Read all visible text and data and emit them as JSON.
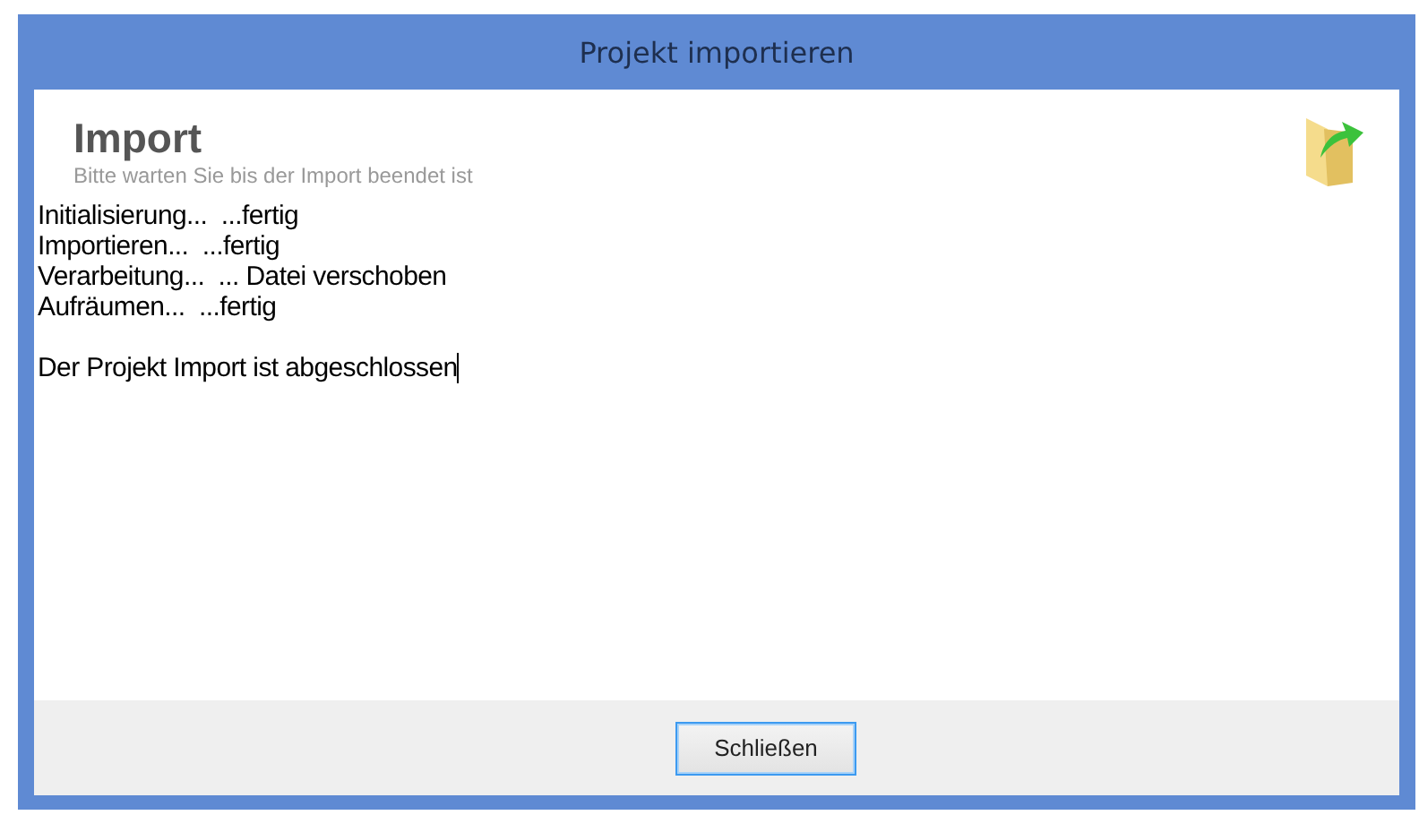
{
  "window": {
    "title": "Projekt importieren"
  },
  "header": {
    "title": "Import",
    "subtitle": "Bitte warten Sie bis der Import beendet ist"
  },
  "log": {
    "steps": [
      "Initialisierung...  ...fertig",
      "Importieren...  ...fertig",
      "Verarbeitung...  ... Datei verschoben",
      "Aufräumen...  ...fertig"
    ],
    "message": "Der Projekt Import ist abgeschlossen"
  },
  "buttons": [
    {
      "label": "Schließen",
      "focused": true
    }
  ]
}
